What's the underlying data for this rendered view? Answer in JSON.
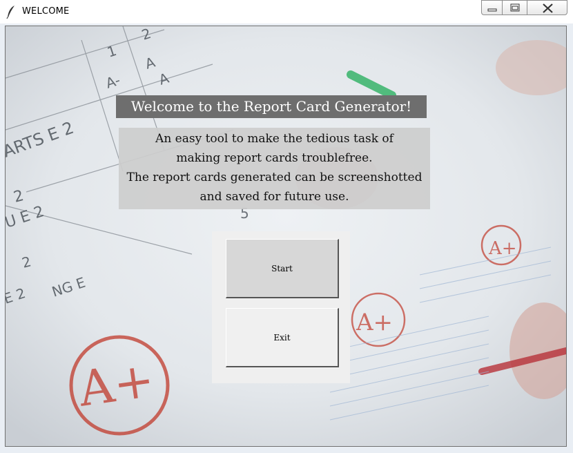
{
  "window": {
    "title": "WELCOME"
  },
  "content": {
    "heading": "Welcome to the Report Card Generator!",
    "description": [
      "An easy tool to make the tedious task of",
      "making report cards troublefree.",
      "The report cards generated can be screenshotted",
      "and saved for future use."
    ]
  },
  "background": {
    "grade_marks": [
      "1",
      "2",
      "A-",
      "A",
      "A",
      "ARTS E 2",
      "2",
      "U E 2",
      "2",
      "E 2",
      "NG E",
      "A+",
      "A+",
      "A+",
      "5"
    ]
  },
  "buttons": {
    "start_label": "Start",
    "exit_label": "Exit"
  },
  "colors": {
    "heading_bg": "#6e6e6e",
    "panel_bg": "#efefef",
    "grade_red": "#c0392b"
  },
  "icons": {
    "app": "feather-icon",
    "minimize": "minimize-icon",
    "maximize": "maximize-icon",
    "close": "close-icon"
  }
}
